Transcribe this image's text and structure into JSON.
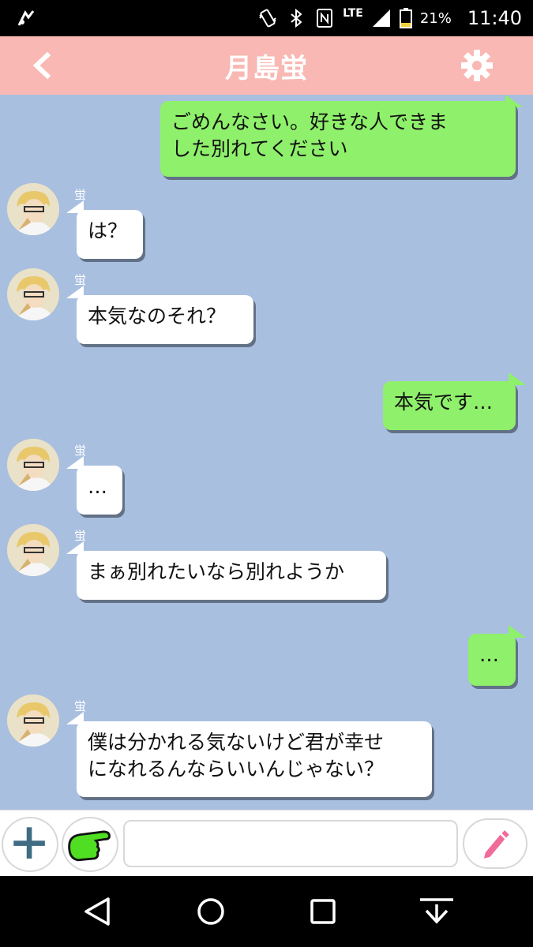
{
  "status_bar": {
    "lte": "LTE",
    "battery_percent": "21%",
    "time": "11:40"
  },
  "header": {
    "title": "月島蛍",
    "back_icon": "chevron-left-icon",
    "settings_icon": "gear-icon",
    "background_color": "#f9b8b3"
  },
  "chat": {
    "background_color": "#a8bfdf",
    "messages": [
      {
        "direction": "out",
        "lines": [
          "ごめんなさい。好きな人できま",
          "した別れてください"
        ]
      },
      {
        "direction": "in",
        "sender": "蛍",
        "lines": [
          "は？"
        ]
      },
      {
        "direction": "in",
        "sender": "蛍",
        "lines": [
          "本気なのそれ？"
        ]
      },
      {
        "direction": "out",
        "lines": [
          "本気です…"
        ]
      },
      {
        "direction": "in",
        "sender": "蛍",
        "lines": [
          "…"
        ]
      },
      {
        "direction": "in",
        "sender": "蛍",
        "lines": [
          "まぁ別れたいなら別れようか"
        ]
      },
      {
        "direction": "out",
        "lines": [
          "…"
        ]
      },
      {
        "direction": "in",
        "sender": "蛍",
        "lines": [
          "僕は分かれる気ないけど君が幸せ",
          "になれるんならいいんじゃない？"
        ]
      }
    ]
  },
  "input_bar": {
    "add_icon": "plus-icon",
    "sticker_icon": "pointing-hand-icon",
    "input_value": "",
    "send_icon": "pencil-icon"
  },
  "nav_bar": {
    "back_icon": "triangle-back-icon",
    "home_icon": "circle-home-icon",
    "recents_icon": "square-recents-icon",
    "hide_keyboard_icon": "hide-keyboard-icon"
  }
}
